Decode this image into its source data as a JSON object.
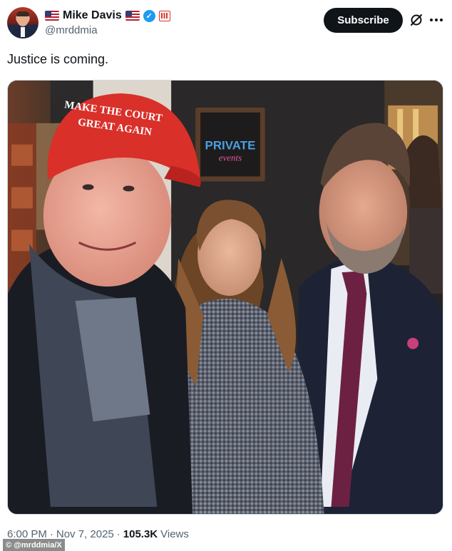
{
  "author": {
    "display_name": "Mike Davis",
    "handle": "@mrddmia",
    "flag_icons": [
      "us-flag-icon",
      "us-flag-icon"
    ],
    "verified_icon": "verified-badge-icon",
    "affiliate_icon": "affiliate-badge-icon"
  },
  "actions": {
    "subscribe_label": "Subscribe",
    "grok_icon": "grok-icon",
    "more_icon": "more-options-icon"
  },
  "tweet": {
    "text": "Justice is coming.",
    "photo": {
      "hat_text_line1": "MAKE THE COURT",
      "hat_text_line2": "GREAT AGAIN",
      "sign_text_line1": "PRIVATE",
      "sign_text_line2": "events"
    }
  },
  "meta": {
    "time": "6:00 PM",
    "separator1": "·",
    "date": "Nov 7, 2025",
    "separator2": "·",
    "views_count": "105.3K",
    "views_label": "Views"
  },
  "credit": "© @mrddmia/X",
  "colors": {
    "subscribe_bg": "#0f1419",
    "verified_blue": "#1d9bf0",
    "secondary_text": "#536471",
    "hat_red": "#d9302a"
  }
}
